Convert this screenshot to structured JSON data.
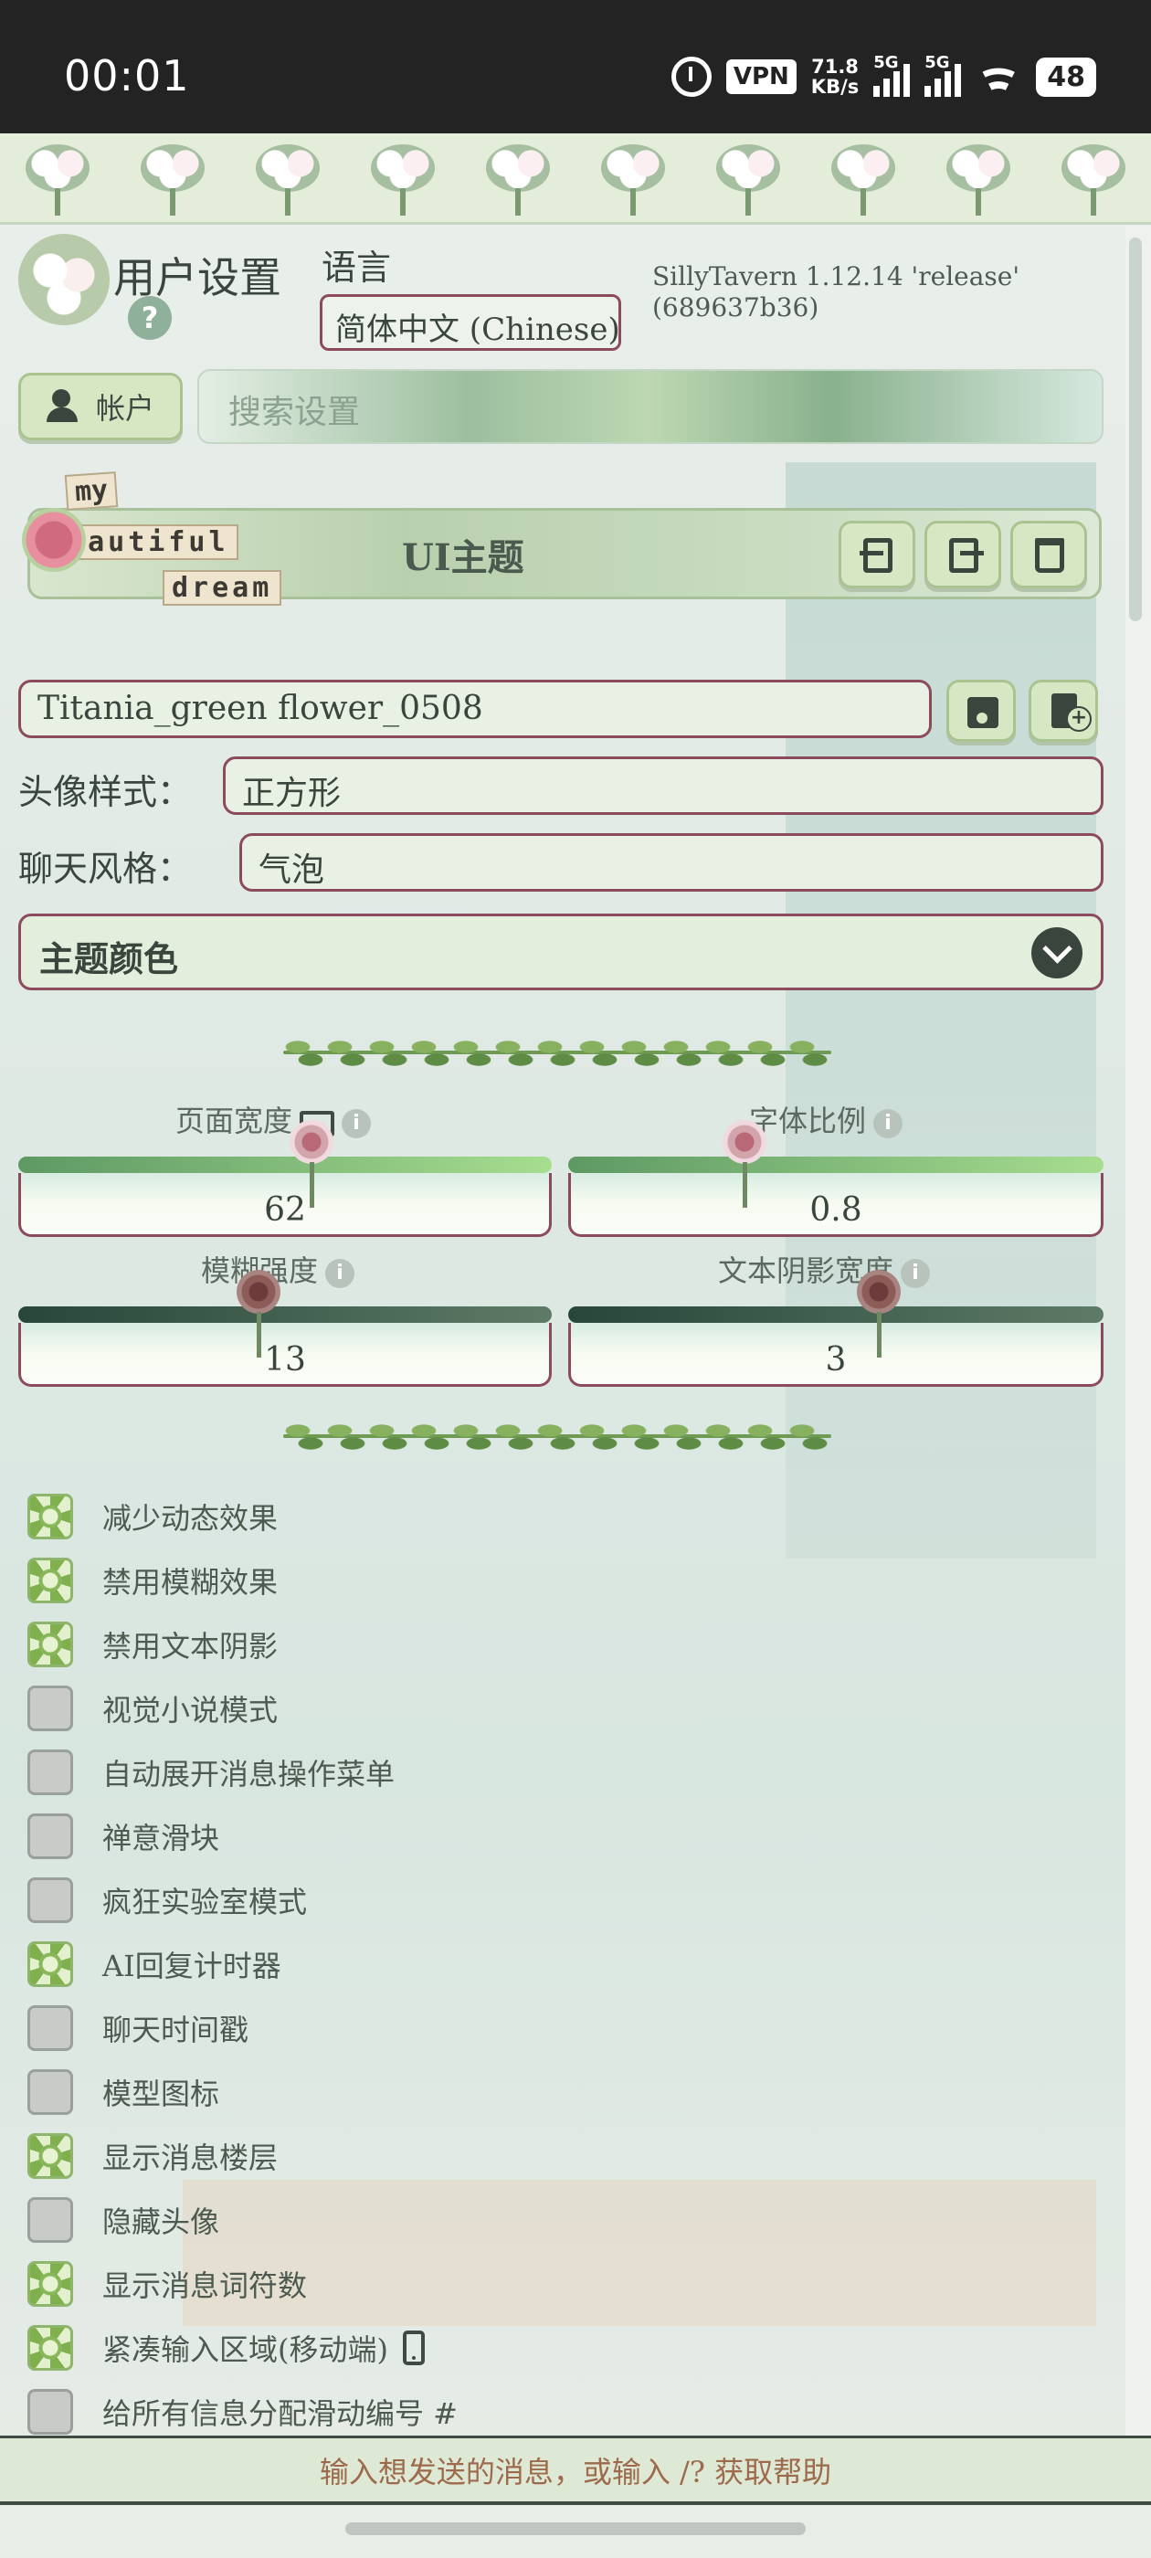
{
  "status_bar": {
    "time": "00:01",
    "vpn": "VPN",
    "speed_top": "71.8",
    "speed_bottom": "KB/s",
    "sig1": "5G",
    "sig2": "5G",
    "battery": "48"
  },
  "header": {
    "title": "用户设置",
    "help": "?",
    "language_label": "语言",
    "language_value": "简体中文 (Chinese)",
    "version": "SillyTavern 1.12.14 'release' (689637b36)"
  },
  "account": {
    "label": "帐户"
  },
  "search": {
    "placeholder": "搜索设置"
  },
  "theme": {
    "stamp_words": [
      "my",
      "beautiful",
      "dream"
    ],
    "title": "UI主题",
    "current": "Titania_green flower_0508",
    "avatar_label": "头像样式：",
    "avatar_value": "正方形",
    "chat_label": "聊天风格：",
    "chat_value": "气泡",
    "colors_label": "主题颜色"
  },
  "sliders": [
    {
      "label": "页面宽度",
      "value": "62",
      "level": 0.55,
      "style": "light",
      "icon": "monitor-icon"
    },
    {
      "label": "字体比例",
      "value": "0.8",
      "level": 0.33,
      "style": "light"
    },
    {
      "label": "模糊强度",
      "value": "13",
      "level": 0.45,
      "style": "dark"
    },
    {
      "label": "文本阴影宽度",
      "value": "3",
      "level": 0.58,
      "style": "dark"
    }
  ],
  "options": [
    {
      "label": "减少动态效果",
      "checked": true
    },
    {
      "label": "禁用模糊效果",
      "checked": true
    },
    {
      "label": "禁用文本阴影",
      "checked": true
    },
    {
      "label": "视觉小说模式",
      "checked": false
    },
    {
      "label": "自动展开消息操作菜单",
      "checked": false
    },
    {
      "label": "禅意滑块",
      "checked": false
    },
    {
      "label": "疯狂实验室模式",
      "checked": false
    },
    {
      "label": "AI回复计时器",
      "checked": true
    },
    {
      "label": "聊天时间戳",
      "checked": false
    },
    {
      "label": "模型图标",
      "checked": false
    },
    {
      "label": "显示消息楼层",
      "checked": true
    },
    {
      "label": "隐藏头像",
      "checked": false
    },
    {
      "label": "显示消息词符数",
      "checked": true
    },
    {
      "label": "紧凑输入区域(移动端)",
      "checked": true,
      "icon": "phone-icon"
    },
    {
      "label": "给所有信息分配滑动编号 #",
      "checked": false
    }
  ],
  "bottom_input": {
    "text": "输入想发送的消息，或输入 /? 获取帮助"
  }
}
